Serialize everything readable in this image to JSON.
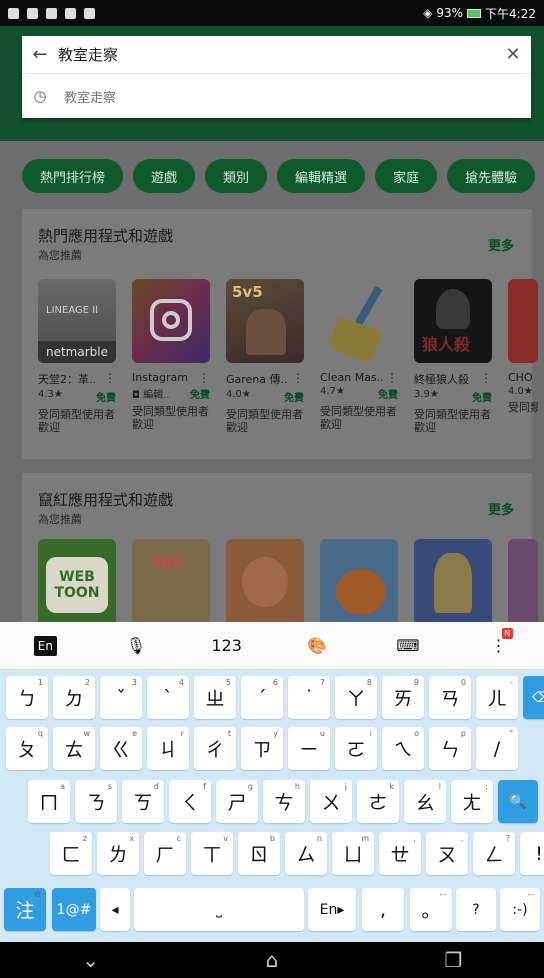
{
  "status_bar": {
    "battery": "93%",
    "time": "下午4:22"
  },
  "search": {
    "query": "教室走察",
    "suggestion": "教室走察"
  },
  "chips": [
    "熱門排行榜",
    "遊戲",
    "類別",
    "編輯精選",
    "家庭",
    "搶先體驗"
  ],
  "section_hot": {
    "title": "熱門應用程式和遊戲",
    "subtitle": "為您推薦",
    "more": "更多",
    "apps": [
      {
        "name": "天堂2：革..",
        "rating": "4.3★",
        "price": "免費",
        "tag": "受同類型使用者歡迎"
      },
      {
        "name": "Instagram",
        "rating": "◘ 編輯..",
        "price": "免費",
        "tag": "受同類型使用者歡迎"
      },
      {
        "name": "Garena 傳..",
        "rating": "4.0★",
        "price": "免費",
        "tag": "受同類型使用者歡迎"
      },
      {
        "name": "Clean Mas..",
        "rating": "4.7★",
        "price": "免費",
        "tag": "受同類型使用者歡迎"
      },
      {
        "name": "終極狼人殺",
        "rating": "3.9★",
        "price": "免費",
        "tag": "受同類型使用者歡迎"
      },
      {
        "name": "CHO",
        "rating": "4.0★",
        "price": "",
        "tag": "受同類型使用者歡迎"
      }
    ]
  },
  "section_new": {
    "title": "竄紅應用程式和遊戲",
    "subtitle": "為您推薦",
    "more": "更多"
  },
  "keyboard": {
    "toolbar": {
      "lang": "En",
      "numbers": "123",
      "badge": "N"
    },
    "row1": [
      {
        "k": "ㄅ",
        "s": "1"
      },
      {
        "k": "ㄉ",
        "s": "2"
      },
      {
        "k": "ˇ",
        "s": "3"
      },
      {
        "k": "ˋ",
        "s": "4"
      },
      {
        "k": "ㄓ",
        "s": "5"
      },
      {
        "k": "ˊ",
        "s": "6"
      },
      {
        "k": "˙",
        "s": "7"
      },
      {
        "k": "ㄚ",
        "s": "8"
      },
      {
        "k": "ㄞ",
        "s": "9"
      },
      {
        "k": "ㄢ",
        "s": "0"
      },
      {
        "k": "ㄦ",
        "s": "-"
      }
    ],
    "row2": [
      {
        "k": "ㄆ",
        "s": "q"
      },
      {
        "k": "ㄊ",
        "s": "w"
      },
      {
        "k": "ㄍ",
        "s": "e"
      },
      {
        "k": "ㄐ",
        "s": "r"
      },
      {
        "k": "ㄔ",
        "s": "t"
      },
      {
        "k": "ㄗ",
        "s": "y"
      },
      {
        "k": "ㄧ",
        "s": "u"
      },
      {
        "k": "ㄛ",
        "s": "i"
      },
      {
        "k": "ㄟ",
        "s": "o"
      },
      {
        "k": "ㄣ",
        "s": "p"
      },
      {
        "k": "/",
        "s": "\""
      }
    ],
    "row3": [
      {
        "k": "ㄇ",
        "s": "a"
      },
      {
        "k": "ㄋ",
        "s": "s"
      },
      {
        "k": "ㄎ",
        "s": "d"
      },
      {
        "k": "ㄑ",
        "s": "f"
      },
      {
        "k": "ㄕ",
        "s": "g"
      },
      {
        "k": "ㄘ",
        "s": "h"
      },
      {
        "k": "ㄨ",
        "s": "j"
      },
      {
        "k": "ㄜ",
        "s": "k"
      },
      {
        "k": "ㄠ",
        "s": "l"
      },
      {
        "k": "ㄤ",
        "s": ";"
      }
    ],
    "row4": [
      {
        "k": "ㄈ",
        "s": "z"
      },
      {
        "k": "ㄌ",
        "s": "x"
      },
      {
        "k": "ㄏ",
        "s": "c"
      },
      {
        "k": "ㄒ",
        "s": "v"
      },
      {
        "k": "ㄖ",
        "s": "b"
      },
      {
        "k": "ㄙ",
        "s": "n"
      },
      {
        "k": "ㄩ",
        "s": "m"
      },
      {
        "k": "ㄝ",
        "s": ","
      },
      {
        "k": "ㄡ",
        "s": "."
      },
      {
        "k": "ㄥ",
        "s": "?"
      },
      {
        "k": "!",
        "s": ""
      }
    ],
    "bottom": {
      "zhuyin": "注",
      "symbols": "1@#",
      "space_lang": "En▸",
      "comma": ",",
      "period": "。",
      "question": "?",
      "emoticon": ":-)"
    }
  }
}
